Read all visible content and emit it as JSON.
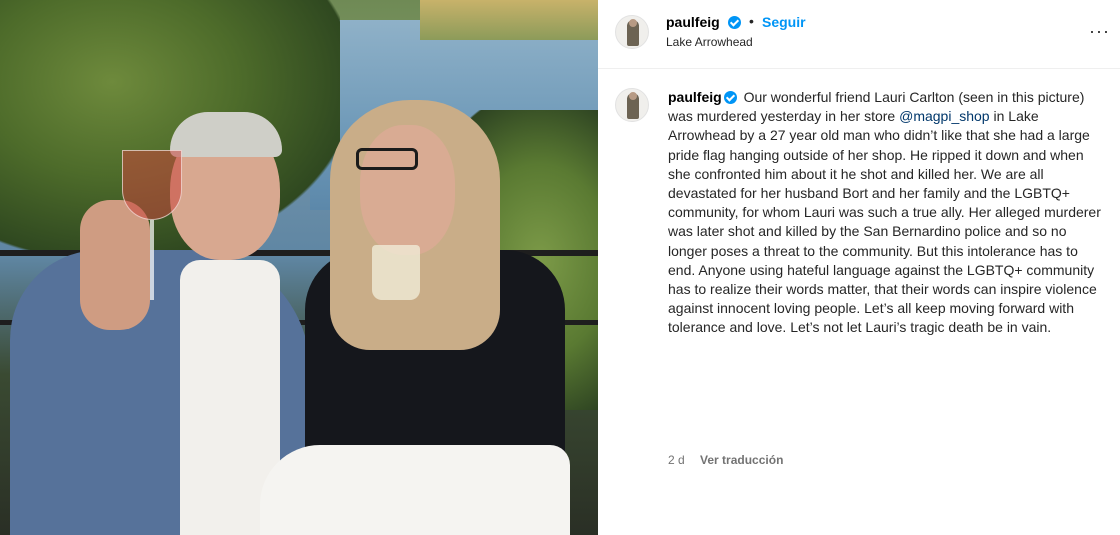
{
  "post": {
    "username": "paulfeig",
    "follow_label": "Seguir",
    "separator": "•",
    "location": "Lake Arrowhead",
    "more_label": "···"
  },
  "caption": {
    "username": "paulfeig",
    "text_part1": "Our wonderful friend Lauri Carlton (seen in this picture) was murdered yesterday in her store ",
    "mention": "@magpi_shop",
    "text_part2": " in Lake Arrowhead by a 27 year old man who didn’t like that she had a large pride flag hanging outside of her shop. He ripped it down and when she confronted him about it he shot and killed her. We are all devastated for her husband Bort and her family and the LGBTQ+ community, for whom Lauri was such a true ally. Her alleged murderer was later shot and killed by the San Bernardino police and so no longer poses a threat to the community. But this intolerance has to end. Anyone using hateful language against the LGBTQ+ community has to realize their words matter, that their words can inspire violence against innocent loving people. Let’s all keep moving forward with tolerance and love. Let’s not let Lauri’s tragic death be in vain.",
    "time_ago": "2 d",
    "translate_label": "Ver traducción"
  },
  "colors": {
    "accent": "#0095f6",
    "mention": "#00376b",
    "muted": "#737373"
  },
  "icons": {
    "verified": "verified-badge-icon",
    "more": "more-options-icon"
  }
}
